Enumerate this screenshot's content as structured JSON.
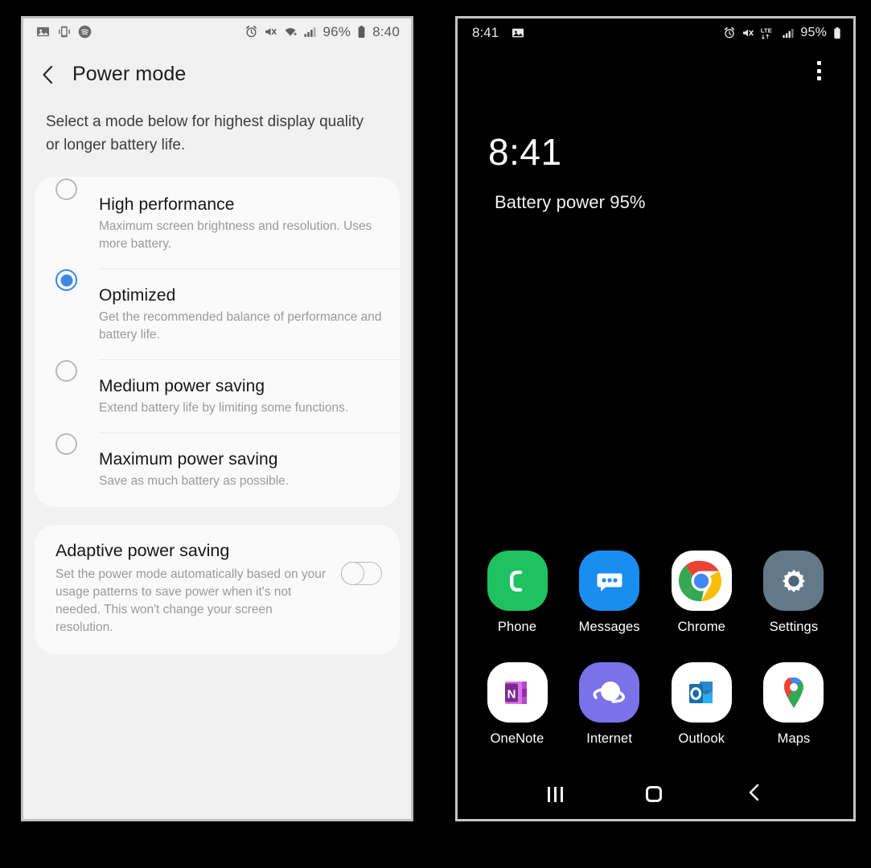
{
  "left_phone": {
    "status_bar": {
      "left_icons": [
        "image-icon",
        "screen-mirror-icon",
        "spotify-icon"
      ],
      "right_icons": [
        "alarm-icon",
        "mute-icon",
        "wifi-icon",
        "signal-icon",
        "battery-icon"
      ],
      "battery_percent": "96%",
      "time": "8:40"
    },
    "header": {
      "back": "back-icon",
      "title": "Power mode"
    },
    "subtitle": "Select a mode below for highest display quality or longer battery life.",
    "modes": [
      {
        "title": "High performance",
        "description": "Maximum screen brightness and resolution. Uses more battery.",
        "selected": false
      },
      {
        "title": "Optimized",
        "description": "Get the recommended balance of performance and battery life.",
        "selected": true
      },
      {
        "title": "Medium power saving",
        "description": "Extend battery life by limiting some functions.",
        "selected": false
      },
      {
        "title": "Maximum power saving",
        "description": "Save as much battery as possible.",
        "selected": false
      }
    ],
    "adaptive": {
      "title": "Adaptive power saving",
      "description": "Set the power mode automatically based on your usage patterns to save power when it's not needed. This won't change your screen resolution.",
      "toggle_on": false
    },
    "accent_color": "#3d87e8"
  },
  "right_phone": {
    "status_bar": {
      "time": "8:41",
      "left_icons": [
        "image-icon"
      ],
      "right_icons": [
        "alarm-icon",
        "mute-icon",
        "lte-icon",
        "signal-icon",
        "battery-icon"
      ],
      "network_label": "LTE",
      "battery_percent": "95%"
    },
    "overflow_menu": "more-options-icon",
    "clock_widget": {
      "time": "8:41",
      "battery_text": "Battery power 95%"
    },
    "apps_row_1": [
      {
        "label": "Phone",
        "icon": "phone-icon"
      },
      {
        "label": "Messages",
        "icon": "messages-icon"
      },
      {
        "label": "Chrome",
        "icon": "chrome-icon"
      },
      {
        "label": "Settings",
        "icon": "settings-gear-icon"
      }
    ],
    "apps_row_2": [
      {
        "label": "OneNote",
        "icon": "onenote-icon"
      },
      {
        "label": "Internet",
        "icon": "internet-browser-icon"
      },
      {
        "label": "Outlook",
        "icon": "outlook-icon"
      },
      {
        "label": "Maps",
        "icon": "maps-pin-icon"
      }
    ],
    "nav_bar": [
      "recents-button",
      "home-button",
      "back-button"
    ]
  }
}
